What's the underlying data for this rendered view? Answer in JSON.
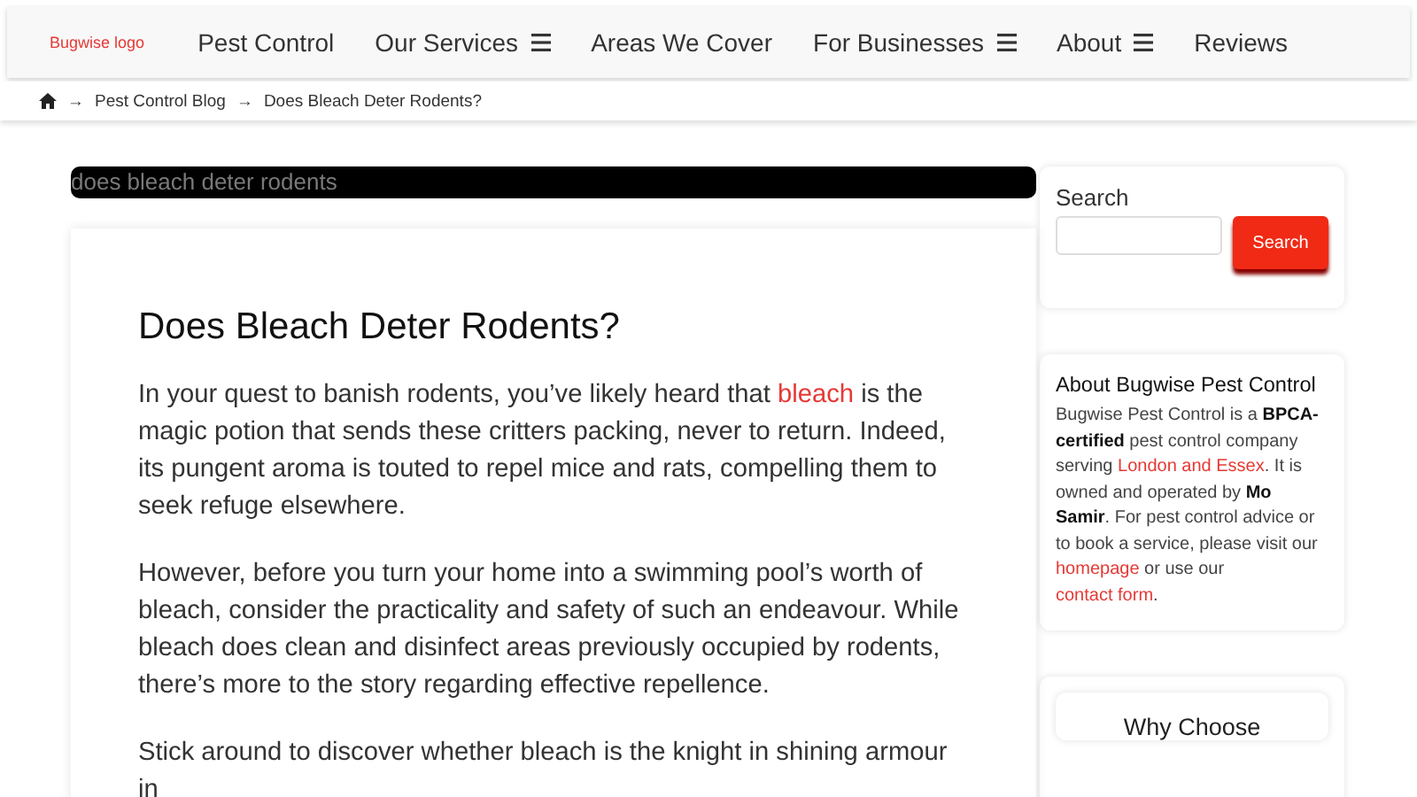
{
  "header": {
    "logo": "Bugwise logo",
    "nav": [
      {
        "label": "Pest Control",
        "has_menu": false
      },
      {
        "label": "Our Services",
        "has_menu": true
      },
      {
        "label": "Areas We Cover",
        "has_menu": false
      },
      {
        "label": "For Businesses",
        "has_menu": true
      },
      {
        "label": "About",
        "has_menu": true
      },
      {
        "label": "Reviews",
        "has_menu": false
      }
    ]
  },
  "breadcrumb": {
    "separator": "→",
    "items": [
      "Pest Control Blog",
      "Does Bleach Deter Rodents?"
    ]
  },
  "title_bar": "does bleach deter rodents",
  "article": {
    "heading": "Does Bleach Deter Rodents?",
    "paragraphs": [
      [
        {
          "kind": "text",
          "text": "In your quest to banish rodents, you’ve likely heard that "
        },
        {
          "kind": "link",
          "text": "bleach"
        },
        {
          "kind": "text",
          "text": " is the magic potion that sends these critters packing, never to return. Indeed, its pungent aroma is touted to repel mice and rats, compelling them to seek refuge elsewhere."
        }
      ],
      [
        {
          "kind": "text",
          "text": "However, before you turn your home into a swimming pool’s worth of bleach, consider the practicality and safety of such an endeavour. While bleach does clean and disinfect areas previously occupied by rodents, there’s more to the story regarding effective repellence."
        }
      ],
      [
        {
          "kind": "text",
          "text": "Stick around to discover whether bleach is the knight in shining armour in"
        }
      ]
    ]
  },
  "sidebar": {
    "search": {
      "label": "Search",
      "button": "Search"
    },
    "about": {
      "heading": "About Bugwise Pest Control",
      "parts": [
        {
          "kind": "text",
          "text": "Bugwise Pest Control is a "
        },
        {
          "kind": "bold",
          "text": "BPCA-certified"
        },
        {
          "kind": "text",
          "text": " pest control company serving "
        },
        {
          "kind": "link",
          "text": "London and Essex"
        },
        {
          "kind": "text",
          "text": ". It is owned and operated by "
        },
        {
          "kind": "bold",
          "text": "Mo Samir"
        },
        {
          "kind": "text",
          "text": ". For pest control advice or to book a service, please visit our "
        },
        {
          "kind": "link",
          "text": "homepage"
        },
        {
          "kind": "text",
          "text": " or use our "
        },
        {
          "kind": "link",
          "text": "contact form"
        },
        {
          "kind": "text",
          "text": "."
        }
      ]
    },
    "why": {
      "heading": "Why Choose"
    }
  }
}
